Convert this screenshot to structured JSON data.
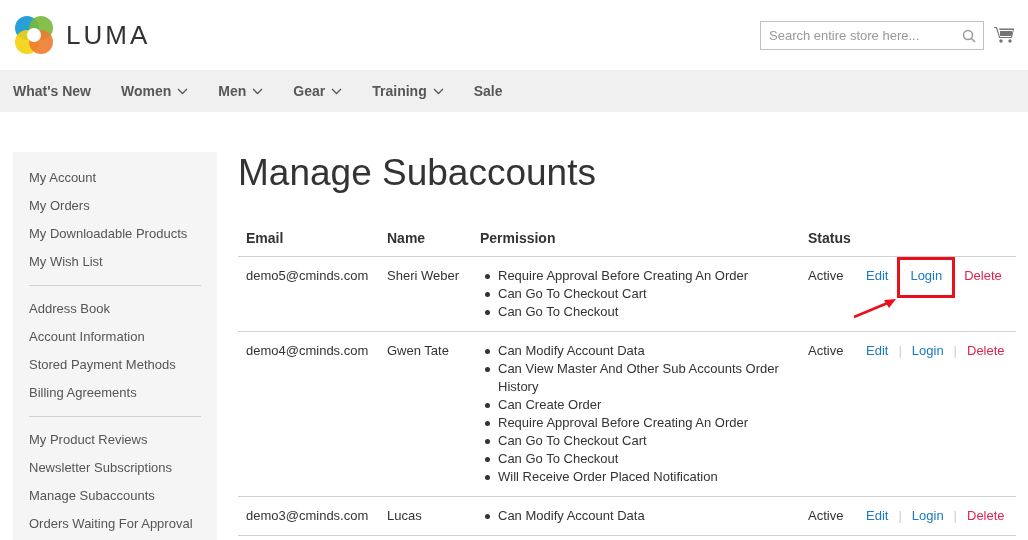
{
  "header": {
    "logo_text": "LUMA",
    "search": {
      "placeholder": "Search entire store here..."
    }
  },
  "nav": [
    {
      "label": "What's New",
      "has_menu": false
    },
    {
      "label": "Women",
      "has_menu": true
    },
    {
      "label": "Men",
      "has_menu": true
    },
    {
      "label": "Gear",
      "has_menu": true
    },
    {
      "label": "Training",
      "has_menu": true
    },
    {
      "label": "Sale",
      "has_menu": false
    }
  ],
  "sidebar": {
    "groups": [
      [
        "My Account",
        "My Orders",
        "My Downloadable Products",
        "My Wish List"
      ],
      [
        "Address Book",
        "Account Information",
        "Stored Payment Methods",
        "Billing Agreements"
      ],
      [
        "My Product Reviews",
        "Newsletter Subscriptions",
        "Manage Subaccounts",
        "Orders Waiting For Approval"
      ]
    ]
  },
  "page_title": "Manage Subaccounts",
  "table": {
    "columns": [
      "Email",
      "Name",
      "Permission",
      "Status"
    ],
    "rows": [
      {
        "email": "demo5@cminds.com",
        "name": "Sheri Weber",
        "permissions": [
          "Require Approval Before Creating An Order",
          "Can Go To Checkout Cart",
          "Can Go To Checkout"
        ],
        "status": "Active",
        "actions": [
          {
            "label": "Edit",
            "kind": "edit",
            "highlighted": false
          },
          {
            "label": "Login",
            "kind": "login",
            "highlighted": true
          },
          {
            "label": "Delete",
            "kind": "delete",
            "highlighted": false
          }
        ]
      },
      {
        "email": "demo4@cminds.com",
        "name": "Gwen Tate",
        "permissions": [
          "Can Modify Account Data",
          "Can View Master And Other Sub Accounts Order History",
          "Can Create Order",
          "Require Approval Before Creating An Order",
          "Can Go To Checkout Cart",
          "Can Go To Checkout",
          "Will Receive Order Placed Notification"
        ],
        "status": "Active",
        "separator": "|",
        "actions": [
          {
            "label": "Edit",
            "kind": "edit",
            "highlighted": false
          },
          {
            "label": "Login",
            "kind": "login",
            "highlighted": false
          },
          {
            "label": "Delete",
            "kind": "delete",
            "highlighted": false
          }
        ]
      },
      {
        "email": "demo3@cminds.com",
        "name": "Lucas",
        "permissions": [
          "Can Modify Account Data"
        ],
        "status": "Active",
        "separator": "|",
        "actions": [
          {
            "label": "Edit",
            "kind": "edit",
            "highlighted": false
          },
          {
            "label": "Login",
            "kind": "login",
            "highlighted": false
          },
          {
            "label": "Delete",
            "kind": "delete",
            "highlighted": false
          }
        ]
      }
    ]
  }
}
